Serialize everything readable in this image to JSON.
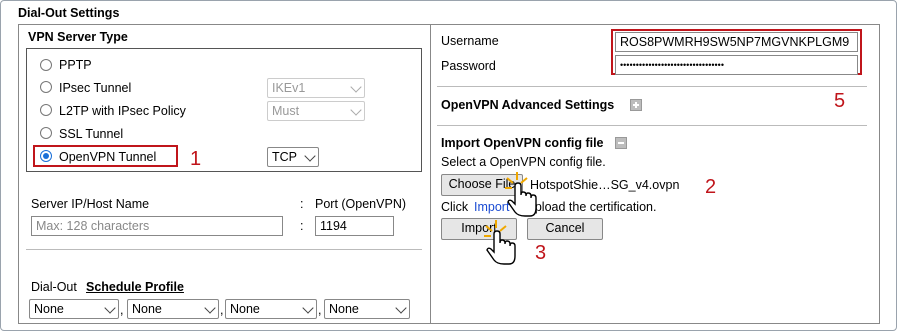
{
  "page": {
    "title": "Dial-Out Settings"
  },
  "vpn_server_type": {
    "heading": "VPN Server Type",
    "options": [
      {
        "label": "PPTP",
        "selected": false
      },
      {
        "label": "IPsec Tunnel",
        "selected": false,
        "select_value": "IKEv1"
      },
      {
        "label": "L2TP with IPsec Policy",
        "selected": false,
        "select_value": "Must"
      },
      {
        "label": "SSL Tunnel",
        "selected": false
      },
      {
        "label": "OpenVPN Tunnel",
        "selected": true,
        "select_value": "TCP"
      }
    ]
  },
  "server": {
    "host_label": "Server IP/Host Name",
    "host_placeholder": "Max: 128 characters",
    "colon": ":",
    "port_label": "Port (OpenVPN)",
    "port_value": "1194"
  },
  "dial_out": {
    "label": "Dial-Out",
    "schedule_label": "Schedule Profile",
    "profiles": [
      "None",
      "None",
      "None",
      "None"
    ],
    "separator": ","
  },
  "credentials": {
    "username_label": "Username",
    "username_value": "ROS8PWMRH9SW5NP7MGVNKPLGM9",
    "password_label": "Password",
    "password_value": "•••••••••••••••••••••••••••••••••"
  },
  "advanced": {
    "label": "OpenVPN Advanced Settings"
  },
  "import": {
    "heading": "Import OpenVPN config file",
    "instruction": "Select a OpenVPN config file.",
    "choose_button": "Choose File",
    "file_name": "HotspotShie…SG_v4.ovpn",
    "click_text": "Click",
    "import_link": "Import",
    "upload_text": "to upload the certification.",
    "import_button": "Import",
    "cancel_button": "Cancel"
  },
  "annotations": {
    "step1": "1",
    "step2": "2",
    "step3": "3",
    "step5": "5",
    "color": "#c0151b"
  }
}
